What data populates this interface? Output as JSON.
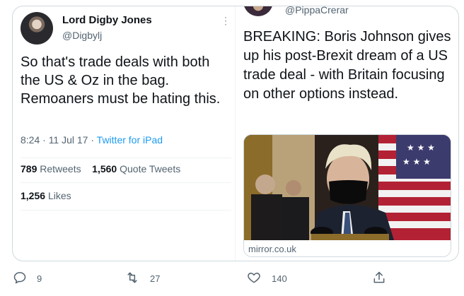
{
  "left_tweet": {
    "name": "Lord Digby Jones",
    "handle": "@Digbylj",
    "more_icon": "⋮",
    "text": "So that's trade deals with both the US & Oz in the bag. Remoaners must be hating this.",
    "timestamp": "8:24 · 11 Jul 17 · ",
    "source": "Twitter for iPad",
    "retweets_count": "789",
    "retweets_label": "Retweets",
    "quotes_count": "1,560",
    "quotes_label": "Quote Tweets",
    "likes_count": "1,256",
    "likes_label": "Likes"
  },
  "right_tweet": {
    "handle": "@PippaCrerar",
    "text": "BREAKING: Boris Johnson gives up his post-Brexit dream of a US trade deal - with  Britain focusing on other options instead.",
    "card_domain": "mirror.co.uk"
  },
  "actions": {
    "reply_count": "9",
    "retweet_count": "27",
    "like_count": "140"
  },
  "icons": {
    "reply": "reply-icon",
    "retweet": "retweet-icon",
    "like": "heart-icon",
    "share": "share-icon"
  }
}
